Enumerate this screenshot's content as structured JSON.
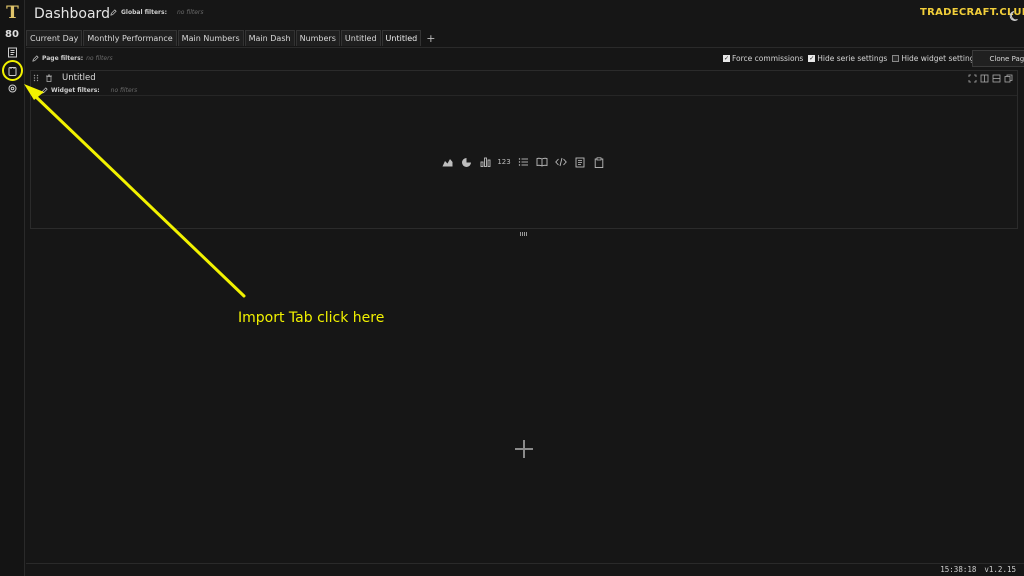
{
  "sidebar": {
    "logo": "T",
    "items": [
      {
        "name": "dashboard-icon",
        "label": "80"
      },
      {
        "name": "notebook-icon"
      },
      {
        "name": "import-tab-icon"
      },
      {
        "name": "settings-icon"
      }
    ]
  },
  "header": {
    "title": "Dashboard",
    "global_filters_label": "Global filters:",
    "global_filters_value": "no filters",
    "brand": "TRADECRAFT.CLUB"
  },
  "tabs": [
    {
      "label": "Current Day"
    },
    {
      "label": "Monthly Performance"
    },
    {
      "label": "Main Numbers"
    },
    {
      "label": "Main Dash"
    },
    {
      "label": "Numbers"
    },
    {
      "label": "Untitled"
    },
    {
      "label": "Untitled",
      "active": true
    }
  ],
  "page_bar": {
    "filters_label": "Page filters:",
    "filters_value": "no filters",
    "options": [
      {
        "label": "Force commissions",
        "checked": true
      },
      {
        "label": "Hide serie settings",
        "checked": true
      },
      {
        "label": "Hide widget settings",
        "checked": false
      }
    ],
    "clone_label": "Clone Page"
  },
  "widget": {
    "title": "Untitled",
    "filters_label": "Widget filters:",
    "filters_value": "no filters",
    "type_icons": [
      "area-chart-icon",
      "pie-chart-icon",
      "bar-chart-icon",
      "number-icon",
      "list-icon",
      "book-icon",
      "code-icon",
      "notes-icon",
      "clipboard-icon"
    ],
    "number_icon_text": "123"
  },
  "annotation": {
    "text": "Import Tab click here",
    "color": "#f2f200"
  },
  "footer": {
    "time": "15:38:18",
    "version": "v1.2.15"
  }
}
